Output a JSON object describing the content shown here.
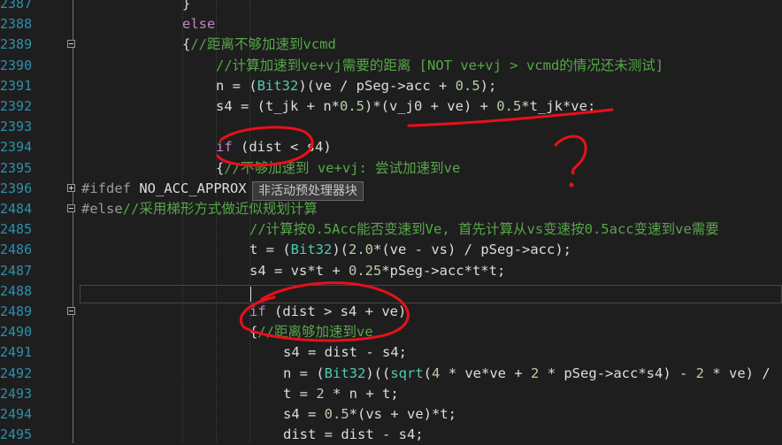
{
  "editor": {
    "inactive_tooltip": "非活动预处理器块",
    "lines": [
      {
        "n": "2387",
        "fold": "",
        "indent": 1,
        "tokens": [
          {
            "c": "tok-txt",
            "t": "}"
          }
        ]
      },
      {
        "n": "2388",
        "fold": "",
        "indent": 1,
        "tokens": [
          {
            "c": "tok-kw",
            "t": "else"
          }
        ]
      },
      {
        "n": "2389",
        "fold": "minus",
        "indent": 1,
        "tokens": [
          {
            "c": "tok-txt",
            "t": "{"
          },
          {
            "c": "tok-cm",
            "t": "//距离不够加速到vcmd"
          }
        ]
      },
      {
        "n": "2390",
        "fold": "",
        "indent": 2,
        "tokens": [
          {
            "c": "tok-cm",
            "t": "//计算加速到ve+vj需要的距离 [NOT ve+vj > vcmd的情况还未测试]"
          }
        ]
      },
      {
        "n": "2391",
        "fold": "",
        "indent": 2,
        "tokens": [
          {
            "c": "tok-txt",
            "t": "n = ("
          },
          {
            "c": "tok-ty",
            "t": "Bit32"
          },
          {
            "c": "tok-txt",
            "t": ")(ve / pSeg->acc + "
          },
          {
            "c": "tok-num",
            "t": "0.5"
          },
          {
            "c": "tok-txt",
            "t": ");"
          }
        ]
      },
      {
        "n": "2392",
        "fold": "",
        "indent": 2,
        "tokens": [
          {
            "c": "tok-txt",
            "t": "s4 = (t_jk + n*"
          },
          {
            "c": "tok-num",
            "t": "0.5"
          },
          {
            "c": "tok-txt",
            "t": ")*(v_j0 + ve) + "
          },
          {
            "c": "tok-num",
            "t": "0.5"
          },
          {
            "c": "tok-txt",
            "t": "*t_jk*ve;"
          }
        ]
      },
      {
        "n": "2393",
        "fold": "",
        "indent": 2,
        "tokens": []
      },
      {
        "n": "2394",
        "fold": "",
        "indent": 2,
        "tokens": [
          {
            "c": "tok-kw",
            "t": "if"
          },
          {
            "c": "tok-txt",
            "t": " (dist < s4)"
          }
        ]
      },
      {
        "n": "2395",
        "fold": "",
        "indent": 2,
        "tokens": [
          {
            "c": "tok-txt",
            "t": "{"
          },
          {
            "c": "tok-cm",
            "t": "//不够加速到 ve+vj: 尝试加速到ve"
          }
        ]
      },
      {
        "n": "2396",
        "fold": "plus",
        "indent": 0,
        "tokens": [
          {
            "c": "tok-pp",
            "t": "#ifdef "
          },
          {
            "c": "tok-txt",
            "t": "NO_ACC_APPROX"
          }
        ],
        "tooltip": true
      },
      {
        "n": "2484",
        "fold": "minus",
        "indent": 0,
        "tokens": [
          {
            "c": "tok-pp",
            "t": "#else"
          },
          {
            "c": "tok-cm",
            "t": "//采用梯形方式做近似规划计算"
          }
        ]
      },
      {
        "n": "2485",
        "fold": "",
        "indent": 3,
        "tokens": [
          {
            "c": "tok-cm",
            "t": "//计算按0.5Acc能否变速到Ve, 首先计算从vs变速按0.5acc变速到ve需要"
          }
        ]
      },
      {
        "n": "2486",
        "fold": "",
        "indent": 3,
        "tokens": [
          {
            "c": "tok-txt",
            "t": "t = ("
          },
          {
            "c": "tok-ty",
            "t": "Bit32"
          },
          {
            "c": "tok-txt",
            "t": ")("
          },
          {
            "c": "tok-num",
            "t": "2.0"
          },
          {
            "c": "tok-txt",
            "t": "*(ve - vs) / pSeg->acc);"
          }
        ]
      },
      {
        "n": "2487",
        "fold": "",
        "indent": 3,
        "tokens": [
          {
            "c": "tok-txt",
            "t": "s4 = vs*t + "
          },
          {
            "c": "tok-num",
            "t": "0.25"
          },
          {
            "c": "tok-txt",
            "t": "*pSeg->acc*t*t;"
          }
        ]
      },
      {
        "n": "2488",
        "fold": "",
        "indent": 3,
        "tokens": []
      },
      {
        "n": "2489",
        "fold": "minus",
        "indent": 3,
        "tokens": [
          {
            "c": "tok-kw",
            "t": "if"
          },
          {
            "c": "tok-txt",
            "t": " (dist > s4 + ve)"
          }
        ]
      },
      {
        "n": "2490",
        "fold": "",
        "indent": 3,
        "tokens": [
          {
            "c": "tok-txt",
            "t": "{"
          },
          {
            "c": "tok-cm",
            "t": "//距离够加速到ve"
          }
        ]
      },
      {
        "n": "2491",
        "fold": "",
        "indent": 4,
        "tokens": [
          {
            "c": "tok-txt",
            "t": "s4 = dist - s4;"
          }
        ]
      },
      {
        "n": "2492",
        "fold": "",
        "indent": 4,
        "tokens": [
          {
            "c": "tok-txt",
            "t": "n = ("
          },
          {
            "c": "tok-ty",
            "t": "Bit32"
          },
          {
            "c": "tok-txt",
            "t": ")(("
          },
          {
            "c": "tok-ty",
            "t": "sqrt"
          },
          {
            "c": "tok-txt",
            "t": "("
          },
          {
            "c": "tok-num",
            "t": "4"
          },
          {
            "c": "tok-txt",
            "t": " * ve*ve + "
          },
          {
            "c": "tok-num",
            "t": "2"
          },
          {
            "c": "tok-txt",
            "t": " * pSeg->acc*s4) - "
          },
          {
            "c": "tok-num",
            "t": "2"
          },
          {
            "c": "tok-txt",
            "t": " * ve) /"
          }
        ]
      },
      {
        "n": "2493",
        "fold": "",
        "indent": 4,
        "tokens": [
          {
            "c": "tok-txt",
            "t": "t = "
          },
          {
            "c": "tok-num",
            "t": "2"
          },
          {
            "c": "tok-txt",
            "t": " * n + t;"
          }
        ]
      },
      {
        "n": "2494",
        "fold": "",
        "indent": 4,
        "tokens": [
          {
            "c": "tok-txt",
            "t": "s4 = "
          },
          {
            "c": "tok-num",
            "t": "0.5"
          },
          {
            "c": "tok-txt",
            "t": "*(vs + ve)*t;"
          }
        ]
      },
      {
        "n": "2495",
        "fold": "",
        "indent": 4,
        "tokens": [
          {
            "c": "tok-txt",
            "t": "dist = dist - s4;"
          }
        ]
      }
    ]
  },
  "annotation": {
    "question_mark": "?"
  }
}
